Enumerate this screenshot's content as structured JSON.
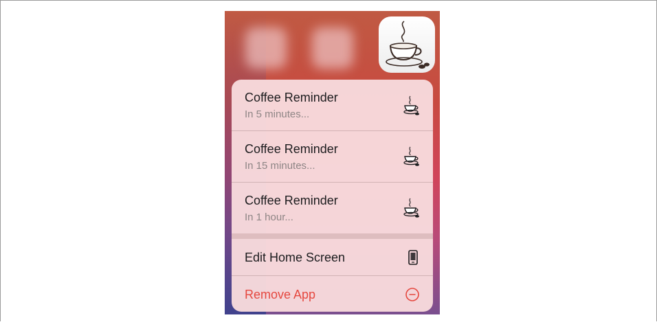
{
  "app_icon": "coffee-cup-icon",
  "quick_actions": [
    {
      "title": "Coffee Reminder",
      "subtitle": "In 5 minutes...",
      "icon": "coffee-cup-icon"
    },
    {
      "title": "Coffee Reminder",
      "subtitle": "In 15 minutes...",
      "icon": "coffee-cup-icon"
    },
    {
      "title": "Coffee Reminder",
      "subtitle": "In 1 hour...",
      "icon": "coffee-cup-icon"
    }
  ],
  "system_actions": {
    "edit_home_screen": {
      "label": "Edit Home Screen",
      "icon": "phone-icon"
    },
    "remove_app": {
      "label": "Remove App",
      "icon": "minus-circle-icon",
      "color": "#e5483f"
    }
  }
}
